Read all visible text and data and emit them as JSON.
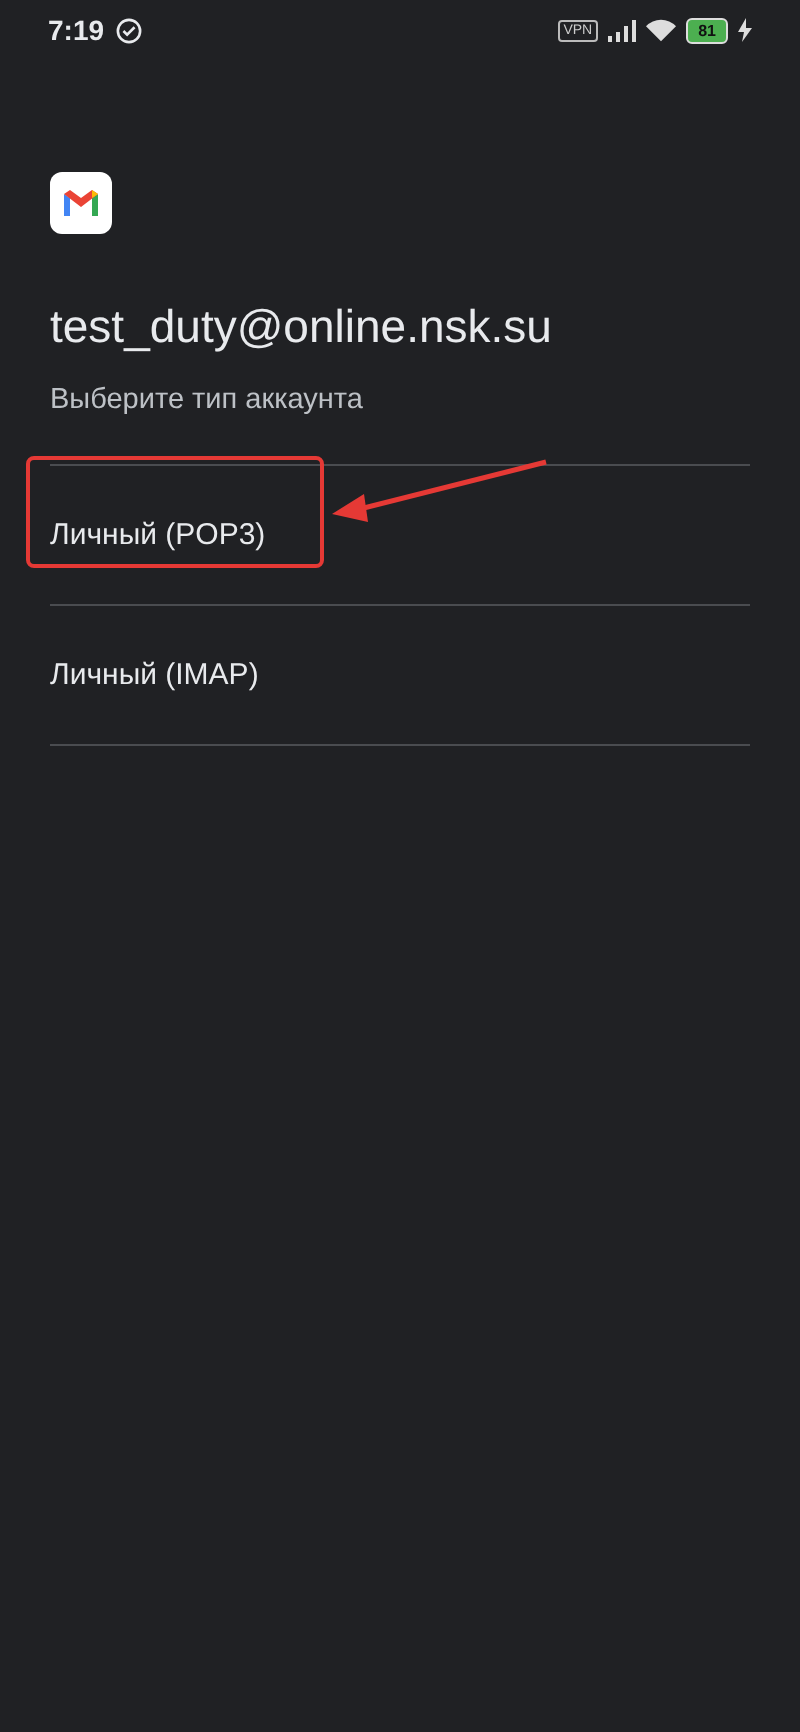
{
  "status_bar": {
    "time": "7:19",
    "vpn": "VPN",
    "battery": "81"
  },
  "account": {
    "email": "test_duty@online.nsk.su",
    "subtitle": "Выберите тип аккаунта"
  },
  "account_types": [
    {
      "label": "Личный (POP3)",
      "highlighted": true
    },
    {
      "label": "Личный (IMAP)",
      "highlighted": false
    }
  ]
}
